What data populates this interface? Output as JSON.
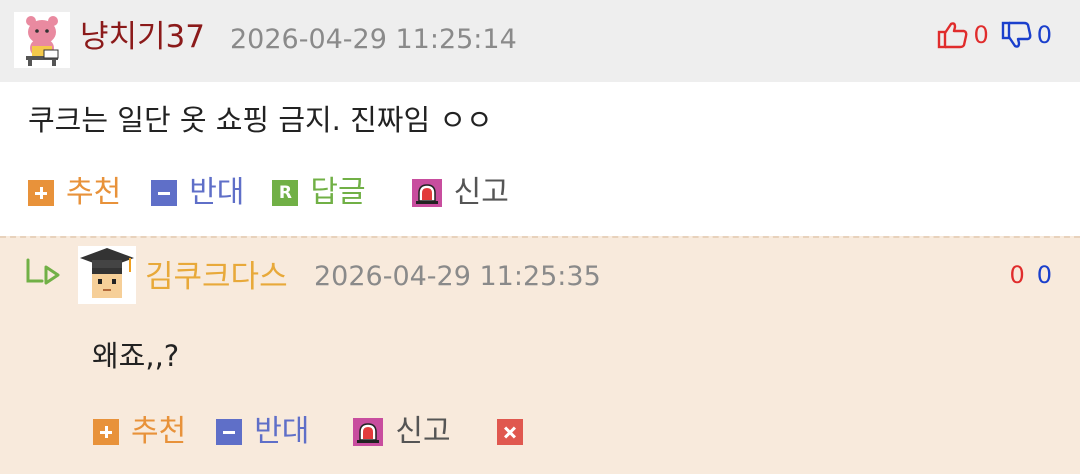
{
  "comment": {
    "author": "냥치기37",
    "date": "2026-04-29 11:25:14",
    "up_count": "0",
    "down_count": "0",
    "text": "쿠크는 일단 옷 쇼핑 금지. 진짜임 ㅇㅇ",
    "actions": {
      "recommend": "추천",
      "oppose": "반대",
      "reply": "답글",
      "reply_badge": "R",
      "report": "신고"
    }
  },
  "reply": {
    "author": "김쿠크다스",
    "date": "2026-04-29 11:25:35",
    "up_count": "0",
    "down_count": "0",
    "text": "왜죠,,?",
    "actions": {
      "recommend": "추천",
      "oppose": "반대",
      "report": "신고"
    }
  },
  "colors": {
    "author_comment": "#8b1a1a",
    "author_reply": "#e8a93a",
    "recommend": "#e8923a",
    "oppose": "#5f6fc8",
    "reply_btn": "#71b046",
    "report_icon": "#c84d9e",
    "delete": "#e0584f",
    "up_red": "#e02c2c",
    "down_blue": "#1a3fcc",
    "header_bg": "#eeeeee",
    "reply_bg": "#f8eadc"
  },
  "icons": [
    "pink-bear-avatar",
    "thumbs-up-icon",
    "thumbs-down-icon",
    "reply-arrow-icon",
    "graduate-avatar",
    "siren-icon",
    "delete-icon"
  ]
}
